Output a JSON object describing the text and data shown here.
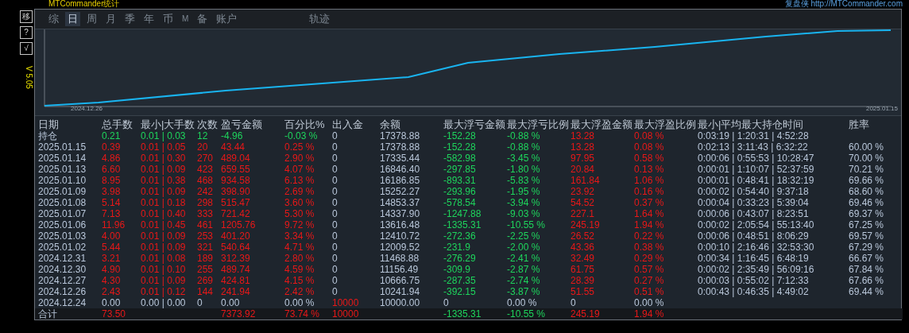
{
  "title": "MTCommander统计",
  "site": "复盘侠 http://MTCommander.com",
  "toolbar": [
    "移",
    "?",
    "√"
  ],
  "version": "V 5.05",
  "tabs": [
    {
      "label": "综",
      "selected": false
    },
    {
      "label": "日",
      "selected": true
    },
    {
      "label": "周",
      "selected": false
    },
    {
      "label": "月",
      "selected": false
    },
    {
      "label": "季",
      "selected": false
    },
    {
      "label": "年",
      "selected": false
    },
    {
      "label": "币",
      "selected": false
    },
    {
      "label": "M",
      "selected": false
    },
    {
      "label": "备",
      "selected": false
    },
    {
      "label": "账户",
      "selected": false
    },
    {
      "label": "轨迹",
      "selected": false
    }
  ],
  "chart": {
    "start_label": "2024.12.26",
    "end_label": "2025.01.15"
  },
  "table": {
    "columns": [
      "日期",
      "总手数",
      "最小|大手数",
      "次数",
      "盈亏金额",
      "百分比%",
      "出入金",
      "余额",
      "最大浮亏金额",
      "最大浮亏比例",
      "最大浮盈金额",
      "最大浮盈比例",
      "最小|平均最大持仓时间",
      "胜率"
    ],
    "rows": [
      [
        {
          "text": "持仓"
        },
        {
          "text": "0.21",
          "color": "#1ed45c"
        },
        {
          "text": "0.01 | 0.03",
          "color": "#1ed45c"
        },
        {
          "text": "12",
          "color": "#1ed45c"
        },
        {
          "text": "-4.96",
          "color": "#1ed45c"
        },
        {
          "text": "-0.03 %",
          "color": "#1ed45c"
        },
        {
          "text": "0",
          "color": "#b9c7da"
        },
        {
          "text": "17378.88",
          "color": "#b9c7da"
        },
        {
          "text": "-152.28",
          "color": "#1ed45c"
        },
        {
          "text": "-0.88 %",
          "color": "#1ed45c"
        },
        {
          "text": "13.28",
          "color": "#e81818"
        },
        {
          "text": "0.08 %",
          "color": "#e81818"
        },
        {
          "text": "0:03:19 | 1:20:31 | 4:52:28",
          "color": "#b9c7da"
        }
      ],
      [
        {
          "text": "2025.01.15",
          "color": "#b9c7da"
        },
        {
          "text": "0.39",
          "color": "#e81818"
        },
        {
          "text": "0.01 | 0.05",
          "color": "#e81818"
        },
        {
          "text": "20",
          "color": "#e81818"
        },
        {
          "text": "43.44",
          "color": "#e81818"
        },
        {
          "text": "0.25 %",
          "color": "#e81818"
        },
        {
          "text": "0",
          "color": "#b9c7da"
        },
        {
          "text": "17378.88",
          "color": "#b9c7da"
        },
        {
          "text": "-152.28",
          "color": "#1ed45c"
        },
        {
          "text": "-0.88 %",
          "color": "#1ed45c"
        },
        {
          "text": "13.28",
          "color": "#e81818"
        },
        {
          "text": "0.08 %",
          "color": "#e81818"
        },
        {
          "text": "0:02:13 | 3:11:43 | 6:32:22",
          "color": "#b9c7da"
        },
        {
          "text": "60.00 %",
          "color": "#b9c7da"
        }
      ],
      [
        {
          "text": "2025.01.14",
          "color": "#b9c7da"
        },
        {
          "text": "4.86",
          "color": "#e81818"
        },
        {
          "text": "0.01 | 0.30",
          "color": "#e81818"
        },
        {
          "text": "270",
          "color": "#e81818"
        },
        {
          "text": "489.04",
          "color": "#e81818"
        },
        {
          "text": "2.90 %",
          "color": "#e81818"
        },
        {
          "text": "0",
          "color": "#b9c7da"
        },
        {
          "text": "17335.44",
          "color": "#b9c7da"
        },
        {
          "text": "-582.98",
          "color": "#1ed45c"
        },
        {
          "text": "-3.45 %",
          "color": "#1ed45c"
        },
        {
          "text": "97.95",
          "color": "#e81818"
        },
        {
          "text": "0.58 %",
          "color": "#e81818"
        },
        {
          "text": "0:00:06 | 0:55:53 | 10:28:47",
          "color": "#b9c7da"
        },
        {
          "text": "70.00 %",
          "color": "#b9c7da"
        }
      ],
      [
        {
          "text": "2025.01.13",
          "color": "#b9c7da"
        },
        {
          "text": "6.60",
          "color": "#e81818"
        },
        {
          "text": "0.01 | 0.09",
          "color": "#e81818"
        },
        {
          "text": "423",
          "color": "#e81818"
        },
        {
          "text": "659.55",
          "color": "#e81818"
        },
        {
          "text": "4.07 %",
          "color": "#e81818"
        },
        {
          "text": "0",
          "color": "#b9c7da"
        },
        {
          "text": "16846.40",
          "color": "#b9c7da"
        },
        {
          "text": "-297.85",
          "color": "#1ed45c"
        },
        {
          "text": "-1.80 %",
          "color": "#1ed45c"
        },
        {
          "text": "20.84",
          "color": "#e81818"
        },
        {
          "text": "0.13 %",
          "color": "#e81818"
        },
        {
          "text": "0:00:01 | 1:10:07 | 52:37:59",
          "color": "#b9c7da"
        },
        {
          "text": "70.21 %",
          "color": "#b9c7da"
        }
      ],
      [
        {
          "text": "2025.01.10",
          "color": "#b9c7da"
        },
        {
          "text": "8.95",
          "color": "#e81818"
        },
        {
          "text": "0.01 | 0.38",
          "color": "#e81818"
        },
        {
          "text": "468",
          "color": "#e81818"
        },
        {
          "text": "934.58",
          "color": "#e81818"
        },
        {
          "text": "6.13 %",
          "color": "#e81818"
        },
        {
          "text": "0",
          "color": "#b9c7da"
        },
        {
          "text": "16186.85",
          "color": "#b9c7da"
        },
        {
          "text": "-893.31",
          "color": "#1ed45c"
        },
        {
          "text": "-5.83 %",
          "color": "#1ed45c"
        },
        {
          "text": "161.84",
          "color": "#e81818"
        },
        {
          "text": "1.06 %",
          "color": "#e81818"
        },
        {
          "text": "0:00:01 | 0:48:41 | 18:32:19",
          "color": "#b9c7da"
        },
        {
          "text": "69.66 %",
          "color": "#b9c7da"
        }
      ],
      [
        {
          "text": "2025.01.09",
          "color": "#b9c7da"
        },
        {
          "text": "3.98",
          "color": "#e81818"
        },
        {
          "text": "0.01 | 0.09",
          "color": "#e81818"
        },
        {
          "text": "242",
          "color": "#e81818"
        },
        {
          "text": "398.90",
          "color": "#e81818"
        },
        {
          "text": "2.69 %",
          "color": "#e81818"
        },
        {
          "text": "0",
          "color": "#b9c7da"
        },
        {
          "text": "15252.27",
          "color": "#b9c7da"
        },
        {
          "text": "-293.96",
          "color": "#1ed45c"
        },
        {
          "text": "-1.95 %",
          "color": "#1ed45c"
        },
        {
          "text": "23.92",
          "color": "#e81818"
        },
        {
          "text": "0.16 %",
          "color": "#e81818"
        },
        {
          "text": "0:00:02 | 0:54:40 | 9:37:18",
          "color": "#b9c7da"
        },
        {
          "text": "68.60 %",
          "color": "#b9c7da"
        }
      ],
      [
        {
          "text": "2025.01.08",
          "color": "#b9c7da"
        },
        {
          "text": "5.14",
          "color": "#e81818"
        },
        {
          "text": "0.01 | 0.18",
          "color": "#e81818"
        },
        {
          "text": "298",
          "color": "#e81818"
        },
        {
          "text": "515.47",
          "color": "#e81818"
        },
        {
          "text": "3.60 %",
          "color": "#e81818"
        },
        {
          "text": "0",
          "color": "#b9c7da"
        },
        {
          "text": "14853.37",
          "color": "#b9c7da"
        },
        {
          "text": "-578.54",
          "color": "#1ed45c"
        },
        {
          "text": "-3.94 %",
          "color": "#1ed45c"
        },
        {
          "text": "54.52",
          "color": "#e81818"
        },
        {
          "text": "0.37 %",
          "color": "#e81818"
        },
        {
          "text": "0:00:04 | 0:33:23 | 5:39:04",
          "color": "#b9c7da"
        },
        {
          "text": "69.46 %",
          "color": "#b9c7da"
        }
      ],
      [
        {
          "text": "2025.01.07",
          "color": "#b9c7da"
        },
        {
          "text": "7.13",
          "color": "#e81818"
        },
        {
          "text": "0.01 | 0.40",
          "color": "#e81818"
        },
        {
          "text": "333",
          "color": "#e81818"
        },
        {
          "text": "721.42",
          "color": "#e81818"
        },
        {
          "text": "5.30 %",
          "color": "#e81818"
        },
        {
          "text": "0",
          "color": "#b9c7da"
        },
        {
          "text": "14337.90",
          "color": "#b9c7da"
        },
        {
          "text": "-1247.88",
          "color": "#1ed45c"
        },
        {
          "text": "-9.03 %",
          "color": "#1ed45c"
        },
        {
          "text": "227.1",
          "color": "#e81818"
        },
        {
          "text": "1.64 %",
          "color": "#e81818"
        },
        {
          "text": "0:00:06 | 0:43:07 | 8:23:51",
          "color": "#b9c7da"
        },
        {
          "text": "69.37 %",
          "color": "#b9c7da"
        }
      ],
      [
        {
          "text": "2025.01.06",
          "color": "#b9c7da"
        },
        {
          "text": "11.96",
          "color": "#e81818"
        },
        {
          "text": "0.01 | 0.45",
          "color": "#e81818"
        },
        {
          "text": "461",
          "color": "#e81818"
        },
        {
          "text": "1205.76",
          "color": "#e81818"
        },
        {
          "text": "9.72 %",
          "color": "#e81818"
        },
        {
          "text": "0",
          "color": "#b9c7da"
        },
        {
          "text": "13616.48",
          "color": "#b9c7da"
        },
        {
          "text": "-1335.31",
          "color": "#1ed45c"
        },
        {
          "text": "-10.55 %",
          "color": "#1ed45c"
        },
        {
          "text": "245.19",
          "color": "#e81818"
        },
        {
          "text": "1.94 %",
          "color": "#e81818"
        },
        {
          "text": "0:00:02 | 2:05:54 | 55:13:40",
          "color": "#b9c7da"
        },
        {
          "text": "67.25 %",
          "color": "#b9c7da"
        }
      ],
      [
        {
          "text": "2025.01.03",
          "color": "#b9c7da"
        },
        {
          "text": "4.00",
          "color": "#e81818"
        },
        {
          "text": "0.01 | 0.09",
          "color": "#e81818"
        },
        {
          "text": "253",
          "color": "#e81818"
        },
        {
          "text": "401.20",
          "color": "#e81818"
        },
        {
          "text": "3.34 %",
          "color": "#e81818"
        },
        {
          "text": "0",
          "color": "#b9c7da"
        },
        {
          "text": "12410.72",
          "color": "#b9c7da"
        },
        {
          "text": "-272.36",
          "color": "#1ed45c"
        },
        {
          "text": "-2.25 %",
          "color": "#1ed45c"
        },
        {
          "text": "26.52",
          "color": "#e81818"
        },
        {
          "text": "0.22 %",
          "color": "#e81818"
        },
        {
          "text": "0:00:06 | 0:48:51 | 8:06:29",
          "color": "#b9c7da"
        },
        {
          "text": "69.57 %",
          "color": "#b9c7da"
        }
      ],
      [
        {
          "text": "2025.01.02",
          "color": "#b9c7da"
        },
        {
          "text": "5.44",
          "color": "#e81818"
        },
        {
          "text": "0.01 | 0.09",
          "color": "#e81818"
        },
        {
          "text": "321",
          "color": "#e81818"
        },
        {
          "text": "540.64",
          "color": "#e81818"
        },
        {
          "text": "4.71 %",
          "color": "#e81818"
        },
        {
          "text": "0",
          "color": "#b9c7da"
        },
        {
          "text": "12009.52",
          "color": "#b9c7da"
        },
        {
          "text": "-231.9",
          "color": "#1ed45c"
        },
        {
          "text": "-2.00 %",
          "color": "#1ed45c"
        },
        {
          "text": "43.36",
          "color": "#e81818"
        },
        {
          "text": "0.38 %",
          "color": "#e81818"
        },
        {
          "text": "0:00:10 | 2:16:46 | 32:53:30",
          "color": "#b9c7da"
        },
        {
          "text": "67.29 %",
          "color": "#b9c7da"
        }
      ],
      [
        {
          "text": "2024.12.31",
          "color": "#b9c7da"
        },
        {
          "text": "3.21",
          "color": "#e81818"
        },
        {
          "text": "0.01 | 0.08",
          "color": "#e81818"
        },
        {
          "text": "189",
          "color": "#e81818"
        },
        {
          "text": "312.39",
          "color": "#e81818"
        },
        {
          "text": "2.80 %",
          "color": "#e81818"
        },
        {
          "text": "0",
          "color": "#b9c7da"
        },
        {
          "text": "11468.88",
          "color": "#b9c7da"
        },
        {
          "text": "-276.29",
          "color": "#1ed45c"
        },
        {
          "text": "-2.41 %",
          "color": "#1ed45c"
        },
        {
          "text": "32.49",
          "color": "#e81818"
        },
        {
          "text": "0.29 %",
          "color": "#e81818"
        },
        {
          "text": "0:00:34 | 1:16:45 | 6:48:19",
          "color": "#b9c7da"
        },
        {
          "text": "66.67 %",
          "color": "#b9c7da"
        }
      ],
      [
        {
          "text": "2024.12.30",
          "color": "#b9c7da"
        },
        {
          "text": "4.90",
          "color": "#e81818"
        },
        {
          "text": "0.01 | 0.10",
          "color": "#e81818"
        },
        {
          "text": "255",
          "color": "#e81818"
        },
        {
          "text": "489.74",
          "color": "#e81818"
        },
        {
          "text": "4.59 %",
          "color": "#e81818"
        },
        {
          "text": "0",
          "color": "#b9c7da"
        },
        {
          "text": "11156.49",
          "color": "#b9c7da"
        },
        {
          "text": "-309.9",
          "color": "#1ed45c"
        },
        {
          "text": "-2.87 %",
          "color": "#1ed45c"
        },
        {
          "text": "61.75",
          "color": "#e81818"
        },
        {
          "text": "0.57 %",
          "color": "#e81818"
        },
        {
          "text": "0:00:02 | 2:35:49 | 56:09:16",
          "color": "#b9c7da"
        },
        {
          "text": "67.84 %",
          "color": "#b9c7da"
        }
      ],
      [
        {
          "text": "2024.12.27",
          "color": "#b9c7da"
        },
        {
          "text": "4.30",
          "color": "#e81818"
        },
        {
          "text": "0.01 | 0.09",
          "color": "#e81818"
        },
        {
          "text": "269",
          "color": "#e81818"
        },
        {
          "text": "424.81",
          "color": "#e81818"
        },
        {
          "text": "4.15 %",
          "color": "#e81818"
        },
        {
          "text": "0",
          "color": "#b9c7da"
        },
        {
          "text": "10666.75",
          "color": "#b9c7da"
        },
        {
          "text": "-287.35",
          "color": "#1ed45c"
        },
        {
          "text": "-2.74 %",
          "color": "#1ed45c"
        },
        {
          "text": "28.39",
          "color": "#e81818"
        },
        {
          "text": "0.27 %",
          "color": "#e81818"
        },
        {
          "text": "0:00:03 | 0:55:02 | 7:12:33",
          "color": "#b9c7da"
        },
        {
          "text": "67.66 %",
          "color": "#b9c7da"
        }
      ],
      [
        {
          "text": "2024.12.26",
          "color": "#b9c7da"
        },
        {
          "text": "2.43",
          "color": "#e81818"
        },
        {
          "text": "0.01 | 0.12",
          "color": "#e81818"
        },
        {
          "text": "144",
          "color": "#e81818"
        },
        {
          "text": "241.94",
          "color": "#e81818"
        },
        {
          "text": "2.42 %",
          "color": "#e81818"
        },
        {
          "text": "0",
          "color": "#b9c7da"
        },
        {
          "text": "10241.94",
          "color": "#b9c7da"
        },
        {
          "text": "-392.15",
          "color": "#1ed45c"
        },
        {
          "text": "-3.87 %",
          "color": "#1ed45c"
        },
        {
          "text": "51.55",
          "color": "#e81818"
        },
        {
          "text": "0.51 %",
          "color": "#e81818"
        },
        {
          "text": "0:00:43 | 0:46:35 | 4:49:02",
          "color": "#b9c7da"
        },
        {
          "text": "69.44 %",
          "color": "#b9c7da"
        }
      ],
      [
        {
          "text": "2024.12.24",
          "color": "#b9c7da"
        },
        {
          "text": "0.00",
          "color": "#b9c7da"
        },
        {
          "text": "0.00 | 0.00",
          "color": "#b9c7da"
        },
        {
          "text": "0",
          "color": "#b9c7da"
        },
        {
          "text": "0.00",
          "color": "#b9c7da"
        },
        {
          "text": "0.00 %",
          "color": "#b9c7da"
        },
        {
          "text": "10000",
          "color": "#e81818"
        },
        {
          "text": "10000.00",
          "color": "#b9c7da"
        },
        {
          "text": "0",
          "color": "#b9c7da"
        },
        {
          "text": "0.00 %",
          "color": "#b9c7da"
        },
        {
          "text": "0",
          "color": "#b9c7da"
        },
        {
          "text": "0.00 %",
          "color": "#b9c7da"
        }
      ]
    ],
    "total": {
      "label": {
        "text": "合计"
      },
      "total_lots": {
        "text": "73.50",
        "color": "#e81818"
      },
      "profit": {
        "text": "7373.92",
        "color": "#e81818"
      },
      "percent": {
        "text": "73.74 %",
        "color": "#e81818"
      },
      "deposit": {
        "text": "10000",
        "color": "#e81818"
      },
      "max_float_loss": {
        "text": "-1335.31",
        "color": "#1ed45c"
      },
      "max_float_loss_pct": {
        "text": "-10.55 %",
        "color": "#1ed45c"
      },
      "max_float_profit": {
        "text": "245.19",
        "color": "#e81818"
      },
      "max_float_profit_pct": {
        "text": "1.94 %",
        "color": "#e81818"
      }
    }
  }
}
